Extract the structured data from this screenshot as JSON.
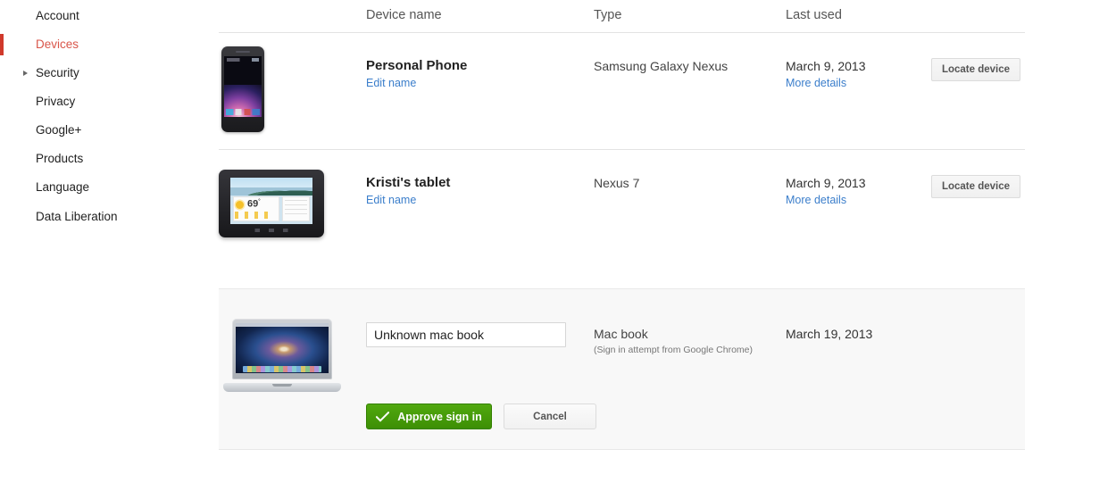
{
  "sidebar": {
    "items": [
      {
        "label": "Account",
        "active": false,
        "has_arrow": false
      },
      {
        "label": "Devices",
        "active": true,
        "has_arrow": false
      },
      {
        "label": "Security",
        "active": false,
        "has_arrow": true
      },
      {
        "label": "Privacy",
        "active": false,
        "has_arrow": false
      },
      {
        "label": "Google+",
        "active": false,
        "has_arrow": false
      },
      {
        "label": "Products",
        "active": false,
        "has_arrow": false
      },
      {
        "label": "Language",
        "active": false,
        "has_arrow": false
      },
      {
        "label": "Data Liberation",
        "active": false,
        "has_arrow": false
      }
    ],
    "active_color": "#d9564a",
    "marker_color": "#d0392b"
  },
  "table": {
    "headers": {
      "device_name": "Device name",
      "type": "Type",
      "last_used": "Last used"
    }
  },
  "devices": [
    {
      "name": "Personal Phone",
      "edit_label": "Edit name",
      "type": "Samsung Galaxy Nexus",
      "last_used": "March 9, 2013",
      "more_details": "More details",
      "locate_label": "Locate device",
      "thumb": "android-phone-thumbnail"
    },
    {
      "name": "Kristi's tablet",
      "edit_label": "Edit name",
      "type": "Nexus 7",
      "last_used": "March 9, 2013",
      "more_details": "More details",
      "locate_label": "Locate device",
      "thumb": "nexus-7-tablet-thumbnail"
    }
  ],
  "pending": {
    "input_value": "Unknown mac book",
    "input_placeholder": "Device name",
    "type": "Mac book",
    "type_sub": "(Sign in attempt from Google Chrome)",
    "last_used": "March 19, 2013",
    "approve_label": "Approve sign in",
    "cancel_label": "Cancel",
    "thumb": "macbook-pro-thumbnail",
    "approve_color": "#3d8f05",
    "panel_bg": "#f8f8f8"
  },
  "tablet_widget": {
    "temperature": "69",
    "degree": "°"
  },
  "link_color": "#3b7ecb"
}
